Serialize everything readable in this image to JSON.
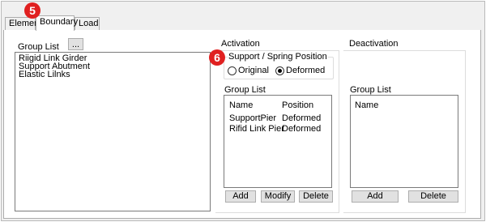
{
  "tabs": [
    {
      "label": "Element"
    },
    {
      "label": "Boundary"
    },
    {
      "label": "Load"
    }
  ],
  "callouts": {
    "tab": "5",
    "option": "6",
    "color": "#e02020"
  },
  "left": {
    "group_list_label": "Group List",
    "browse_label": "...",
    "items": [
      "Riigid Link Girder",
      "Support Abutment",
      "Elastic Lilnks"
    ]
  },
  "activation": {
    "title": "Activation",
    "position_group": {
      "title": "Support / Spring Position",
      "options": [
        {
          "label": "Original",
          "checked": false
        },
        {
          "label": "Deformed",
          "checked": true
        }
      ]
    },
    "group_list_label": "Group List",
    "columns": [
      "Name",
      "Position"
    ],
    "rows": [
      {
        "name": "SupportPier",
        "position": "Deformed"
      },
      {
        "name": "Rifid Link Pier",
        "position": "Deformed"
      }
    ],
    "buttons": {
      "add": "Add",
      "modify": "Modify",
      "delete": "Delete"
    }
  },
  "deactivation": {
    "title": "Deactivation",
    "group_list_label": "Group List",
    "columns": [
      "Name"
    ],
    "buttons": {
      "add": "Add",
      "delete": "Delete"
    }
  }
}
